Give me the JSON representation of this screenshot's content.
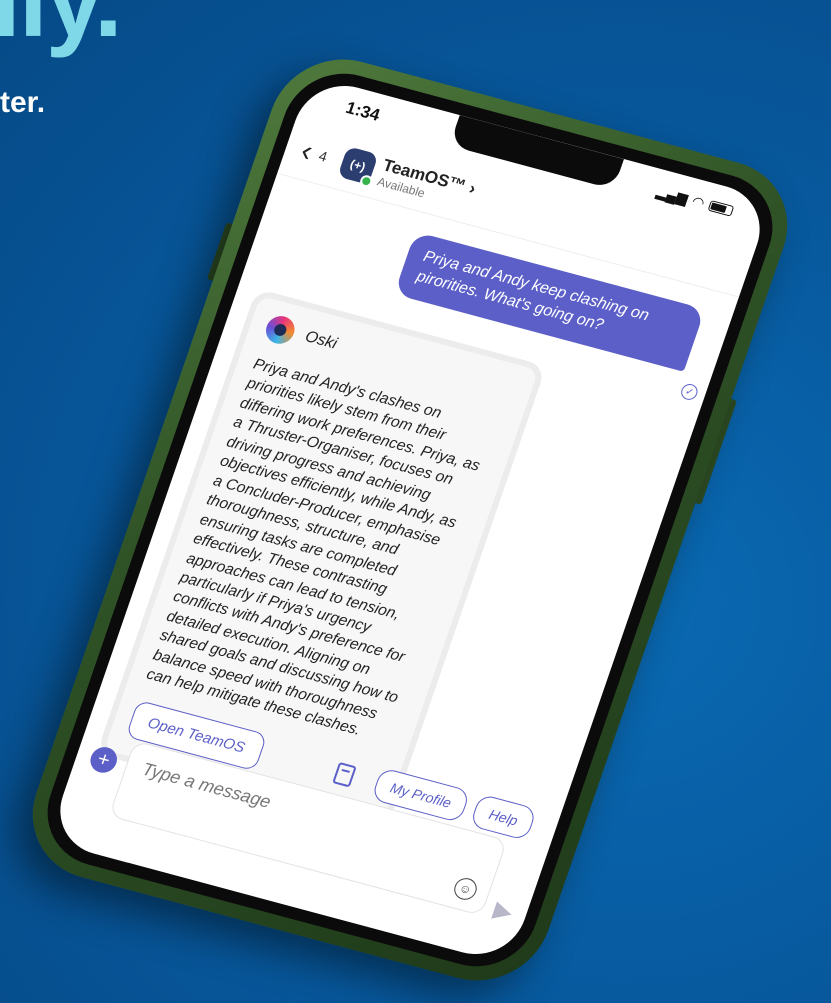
{
  "hero": {
    "headline": "ily.",
    "subhead": "ter."
  },
  "status_bar": {
    "time": "1:34"
  },
  "chat_header": {
    "back_count": "4",
    "bot_name": "TeamOS™ ›",
    "bot_status": "Available"
  },
  "messages": {
    "user_message": "Priya and Andy keep clashing on pirorities. What's going on?",
    "bot_card": {
      "sender": "Oski",
      "body": "Priya and Andy's clashes on priorities likely stem from their differing work preferences. Priya, as a Thruster-Organiser, focuses on driving progress and achieving objectives efficiently, while Andy, as a Concluder-Producer, emphasise thoroughness, structure, and ensuring tasks are completed effectively. These contrasting approaches can lead to tension, particularly if Priya's urgency conflicts with Andy's preference for detailed execution. Aligning on shared goals and discussing how to balance speed with thoroughness can help mitigate these clashes.",
      "button_label": "Open TeamOS"
    }
  },
  "quick_actions": {
    "my_profile": "My Profile",
    "help": "Help"
  },
  "composer": {
    "placeholder": "Type a message"
  },
  "colors": {
    "background": "#07579b",
    "accent": "#5b5fc7",
    "headline": "#7fd8e8",
    "phone_frame": "#2f5226"
  },
  "icons": {
    "back": "chevron-left-icon",
    "bot": "teamos-bot-icon",
    "oski": "oski-avatar-icon",
    "book": "book-icon",
    "plus": "plus-icon",
    "emoji": "emoji-icon",
    "send": "send-icon",
    "read": "read-receipt-icon"
  }
}
